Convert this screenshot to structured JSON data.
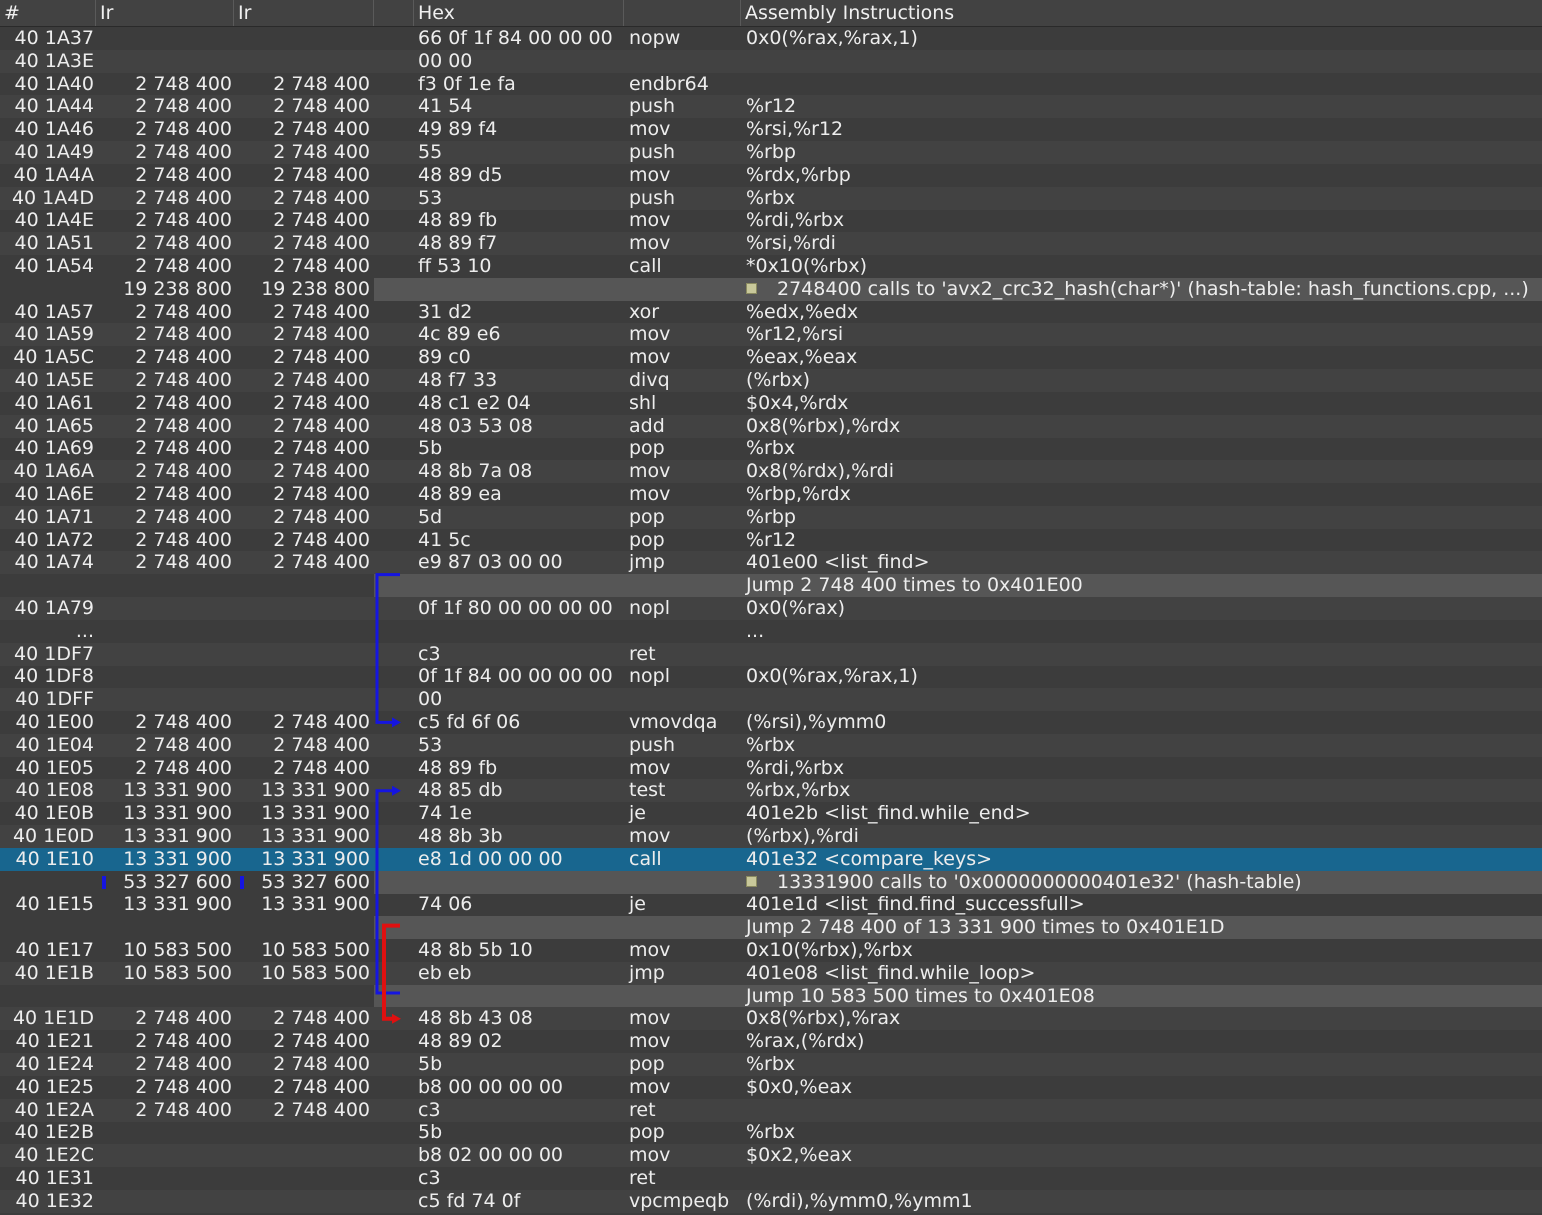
{
  "columns": [
    "#",
    "Ir",
    "Ir",
    "Hex",
    "",
    "Assembly Instructions"
  ],
  "rows": [
    {
      "kind": "instr",
      "addr": "40 1A37",
      "ir1": "",
      "ir2": "",
      "hex": "66 0f 1f 84 00 00 00",
      "op": "nopw",
      "args": "0x0(%rax,%rax,1)"
    },
    {
      "kind": "instr",
      "addr": "40 1A3E",
      "ir1": "",
      "ir2": "",
      "hex": "00 00",
      "op": "",
      "args": ""
    },
    {
      "kind": "instr",
      "addr": "40 1A40",
      "ir1": "2 748 400",
      "ir2": "2 748 400",
      "hex": "f3 0f 1e fa",
      "op": "endbr64",
      "args": ""
    },
    {
      "kind": "instr",
      "addr": "40 1A44",
      "ir1": "2 748 400",
      "ir2": "2 748 400",
      "hex": "41 54",
      "op": "push",
      "args": "%r12"
    },
    {
      "kind": "instr",
      "addr": "40 1A46",
      "ir1": "2 748 400",
      "ir2": "2 748 400",
      "hex": "49 89 f4",
      "op": "mov",
      "args": "%rsi,%r12"
    },
    {
      "kind": "instr",
      "addr": "40 1A49",
      "ir1": "2 748 400",
      "ir2": "2 748 400",
      "hex": "55",
      "op": "push",
      "args": "%rbp"
    },
    {
      "kind": "instr",
      "addr": "40 1A4A",
      "ir1": "2 748 400",
      "ir2": "2 748 400",
      "hex": "48 89 d5",
      "op": "mov",
      "args": "%rdx,%rbp"
    },
    {
      "kind": "instr",
      "addr": "40 1A4D",
      "ir1": "2 748 400",
      "ir2": "2 748 400",
      "hex": "53",
      "op": "push",
      "args": "%rbx"
    },
    {
      "kind": "instr",
      "addr": "40 1A4E",
      "ir1": "2 748 400",
      "ir2": "2 748 400",
      "hex": "48 89 fb",
      "op": "mov",
      "args": "%rdi,%rbx"
    },
    {
      "kind": "instr",
      "addr": "40 1A51",
      "ir1": "2 748 400",
      "ir2": "2 748 400",
      "hex": "48 89 f7",
      "op": "mov",
      "args": "%rsi,%rdi"
    },
    {
      "kind": "instr",
      "addr": "40 1A54",
      "ir1": "2 748 400",
      "ir2": "2 748 400",
      "hex": "ff 53 10",
      "op": "call",
      "args": "*0x10(%rbx)"
    },
    {
      "kind": "call",
      "addr": "",
      "ir1": "19 238 800",
      "ir2": "19 238 800",
      "note": "2748400 calls to 'avx2_crc32_hash(char*)' (hash-table: hash_functions.cpp, ...)"
    },
    {
      "kind": "instr",
      "addr": "40 1A57",
      "ir1": "2 748 400",
      "ir2": "2 748 400",
      "hex": "31 d2",
      "op": "xor",
      "args": "%edx,%edx"
    },
    {
      "kind": "instr",
      "addr": "40 1A59",
      "ir1": "2 748 400",
      "ir2": "2 748 400",
      "hex": "4c 89 e6",
      "op": "mov",
      "args": "%r12,%rsi"
    },
    {
      "kind": "instr",
      "addr": "40 1A5C",
      "ir1": "2 748 400",
      "ir2": "2 748 400",
      "hex": "89 c0",
      "op": "mov",
      "args": "%eax,%eax"
    },
    {
      "kind": "instr",
      "addr": "40 1A5E",
      "ir1": "2 748 400",
      "ir2": "2 748 400",
      "hex": "48 f7 33",
      "op": "divq",
      "args": "(%rbx)"
    },
    {
      "kind": "instr",
      "addr": "40 1A61",
      "ir1": "2 748 400",
      "ir2": "2 748 400",
      "hex": "48 c1 e2 04",
      "op": "shl",
      "args": "$0x4,%rdx"
    },
    {
      "kind": "instr",
      "addr": "40 1A65",
      "ir1": "2 748 400",
      "ir2": "2 748 400",
      "hex": "48 03 53 08",
      "op": "add",
      "args": "0x8(%rbx),%rdx"
    },
    {
      "kind": "instr",
      "addr": "40 1A69",
      "ir1": "2 748 400",
      "ir2": "2 748 400",
      "hex": "5b",
      "op": "pop",
      "args": "%rbx"
    },
    {
      "kind": "instr",
      "addr": "40 1A6A",
      "ir1": "2 748 400",
      "ir2": "2 748 400",
      "hex": "48 8b 7a 08",
      "op": "mov",
      "args": "0x8(%rdx),%rdi"
    },
    {
      "kind": "instr",
      "addr": "40 1A6E",
      "ir1": "2 748 400",
      "ir2": "2 748 400",
      "hex": "48 89 ea",
      "op": "mov",
      "args": "%rbp,%rdx"
    },
    {
      "kind": "instr",
      "addr": "40 1A71",
      "ir1": "2 748 400",
      "ir2": "2 748 400",
      "hex": "5d",
      "op": "pop",
      "args": "%rbp"
    },
    {
      "kind": "instr",
      "addr": "40 1A72",
      "ir1": "2 748 400",
      "ir2": "2 748 400",
      "hex": "41 5c",
      "op": "pop",
      "args": "%r12"
    },
    {
      "kind": "instr",
      "addr": "40 1A74",
      "ir1": "2 748 400",
      "ir2": "2 748 400",
      "hex": "e9 87 03 00 00",
      "op": "jmp",
      "args": "401e00 <list_find>"
    },
    {
      "kind": "jump",
      "note": "Jump 2 748 400 times to 0x401E00"
    },
    {
      "kind": "instr",
      "addr": "40 1A79",
      "ir1": "",
      "ir2": "",
      "hex": "0f 1f 80 00 00 00 00",
      "op": "nopl",
      "args": "0x0(%rax)"
    },
    {
      "kind": "instr",
      "addr": "...",
      "ir1": "",
      "ir2": "",
      "hex": "",
      "op": "",
      "args": "..."
    },
    {
      "kind": "instr",
      "addr": "40 1DF7",
      "ir1": "",
      "ir2": "",
      "hex": "c3",
      "op": "ret",
      "args": ""
    },
    {
      "kind": "instr",
      "addr": "40 1DF8",
      "ir1": "",
      "ir2": "",
      "hex": "0f 1f 84 00 00 00 00",
      "op": "nopl",
      "args": "0x0(%rax,%rax,1)"
    },
    {
      "kind": "instr",
      "addr": "40 1DFF",
      "ir1": "",
      "ir2": "",
      "hex": "00",
      "op": "",
      "args": ""
    },
    {
      "kind": "instr",
      "addr": "40 1E00",
      "ir1": "2 748 400",
      "ir2": "2 748 400",
      "hex": "c5 fd 6f 06",
      "op": "vmovdqa",
      "args": "(%rsi),%ymm0"
    },
    {
      "kind": "instr",
      "addr": "40 1E04",
      "ir1": "2 748 400",
      "ir2": "2 748 400",
      "hex": "53",
      "op": "push",
      "args": "%rbx"
    },
    {
      "kind": "instr",
      "addr": "40 1E05",
      "ir1": "2 748 400",
      "ir2": "2 748 400",
      "hex": "48 89 fb",
      "op": "mov",
      "args": "%rdi,%rbx"
    },
    {
      "kind": "instr",
      "addr": "40 1E08",
      "ir1": "13 331 900",
      "ir2": "13 331 900",
      "hex": "48 85 db",
      "op": "test",
      "args": "%rbx,%rbx"
    },
    {
      "kind": "instr",
      "addr": "40 1E0B",
      "ir1": "13 331 900",
      "ir2": "13 331 900",
      "hex": "74 1e",
      "op": "je",
      "args": "401e2b <list_find.while_end>"
    },
    {
      "kind": "instr",
      "addr": "40 1E0D",
      "ir1": "13 331 900",
      "ir2": "13 331 900",
      "hex": "48 8b 3b",
      "op": "mov",
      "args": "(%rbx),%rdi"
    },
    {
      "kind": "instr",
      "addr": "40 1E10",
      "ir1": "13 331 900",
      "ir2": "13 331 900",
      "hex": "e8 1d 00 00 00",
      "op": "call",
      "args": "401e32 <compare_keys>",
      "selected": true
    },
    {
      "kind": "call",
      "addr": "",
      "ir1": "53 327 600",
      "ir2": "53 327 600",
      "note": "13331900 calls to '0x0000000000401e32' (hash-table)",
      "marks": true
    },
    {
      "kind": "instr",
      "addr": "40 1E15",
      "ir1": "13 331 900",
      "ir2": "13 331 900",
      "hex": "74 06",
      "op": "je",
      "args": "401e1d <list_find.find_successfull>"
    },
    {
      "kind": "jump",
      "note": "Jump 2 748 400 of 13 331 900 times to 0x401E1D"
    },
    {
      "kind": "instr",
      "addr": "40 1E17",
      "ir1": "10 583 500",
      "ir2": "10 583 500",
      "hex": "48 8b 5b 10",
      "op": "mov",
      "args": "0x10(%rbx),%rbx"
    },
    {
      "kind": "instr",
      "addr": "40 1E1B",
      "ir1": "10 583 500",
      "ir2": "10 583 500",
      "hex": "eb eb",
      "op": "jmp",
      "args": "401e08 <list_find.while_loop>"
    },
    {
      "kind": "jump",
      "note": "Jump 10 583 500 times to 0x401E08"
    },
    {
      "kind": "instr",
      "addr": "40 1E1D",
      "ir1": "2 748 400",
      "ir2": "2 748 400",
      "hex": "48 8b 43 08",
      "op": "mov",
      "args": "0x8(%rbx),%rax"
    },
    {
      "kind": "instr",
      "addr": "40 1E21",
      "ir1": "2 748 400",
      "ir2": "2 748 400",
      "hex": "48 89 02",
      "op": "mov",
      "args": "%rax,(%rdx)"
    },
    {
      "kind": "instr",
      "addr": "40 1E24",
      "ir1": "2 748 400",
      "ir2": "2 748 400",
      "hex": "5b",
      "op": "pop",
      "args": "%rbx"
    },
    {
      "kind": "instr",
      "addr": "40 1E25",
      "ir1": "2 748 400",
      "ir2": "2 748 400",
      "hex": "b8 00 00 00 00",
      "op": "mov",
      "args": "$0x0,%eax"
    },
    {
      "kind": "instr",
      "addr": "40 1E2A",
      "ir1": "2 748 400",
      "ir2": "2 748 400",
      "hex": "c3",
      "op": "ret",
      "args": ""
    },
    {
      "kind": "instr",
      "addr": "40 1E2B",
      "ir1": "",
      "ir2": "",
      "hex": "5b",
      "op": "pop",
      "args": "%rbx"
    },
    {
      "kind": "instr",
      "addr": "40 1E2C",
      "ir1": "",
      "ir2": "",
      "hex": "b8 02 00 00 00",
      "op": "mov",
      "args": "$0x2,%eax"
    },
    {
      "kind": "instr",
      "addr": "40 1E31",
      "ir1": "",
      "ir2": "",
      "hex": "c3",
      "op": "ret",
      "args": ""
    },
    {
      "kind": "instr",
      "addr": "40 1E32",
      "ir1": "",
      "ir2": "",
      "hex": "c5 fd 74 0f",
      "op": "vpcmpeqb",
      "args": "(%rdi),%ymm0,%ymm1"
    }
  ],
  "colors": {
    "background": "#3c3c3c",
    "alt_row": "#424242",
    "band": "#565656",
    "selected": "#18668f",
    "jump_forward": "#1515e0",
    "jump_taken": "#e01010"
  }
}
